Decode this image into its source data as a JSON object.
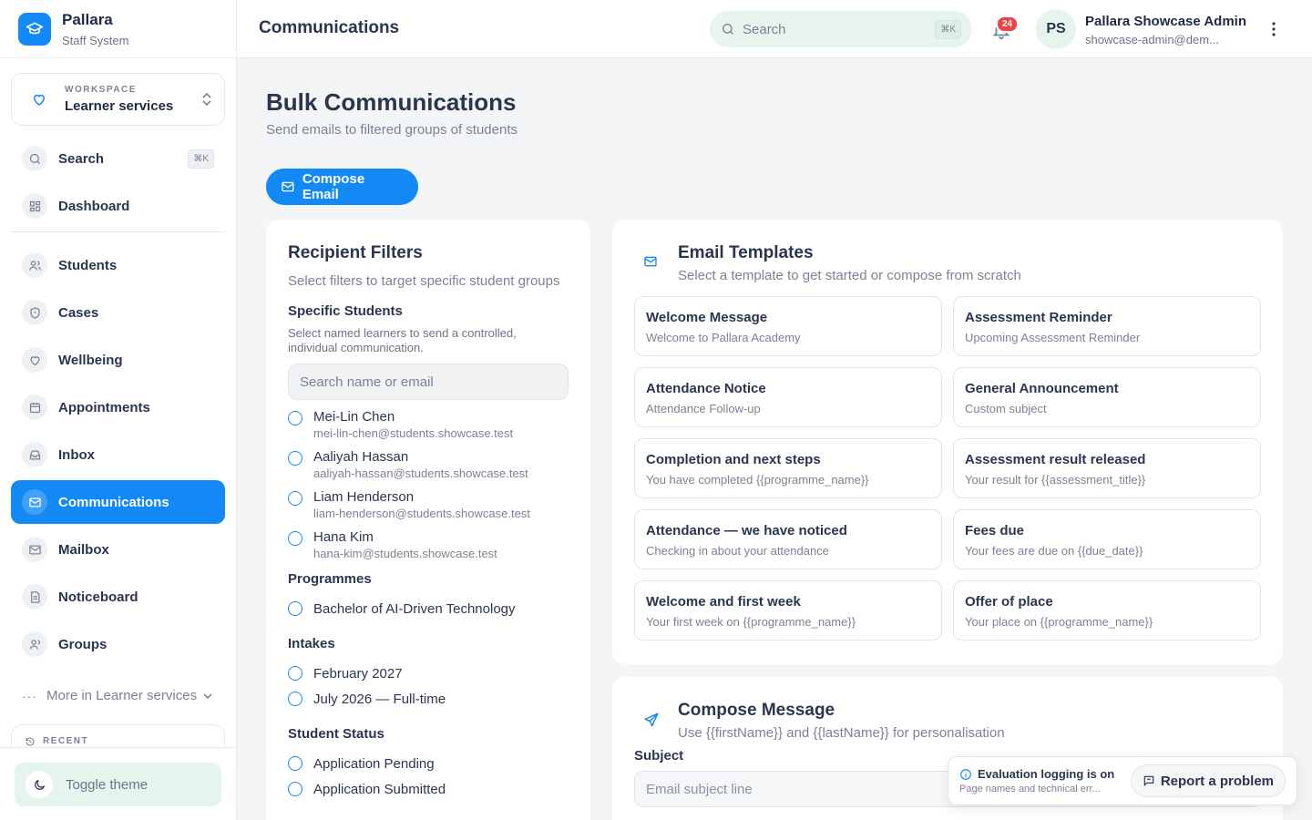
{
  "brand": {
    "name": "Pallara",
    "subtitle": "Staff System"
  },
  "workspace": {
    "label": "WORKSPACE",
    "value": "Learner services"
  },
  "sidebar": {
    "search": {
      "label": "Search",
      "shortcut": "⌘K"
    },
    "dashboard": "Dashboard",
    "items": [
      {
        "label": "Students",
        "icon": "users-icon"
      },
      {
        "label": "Cases",
        "icon": "shield-icon"
      },
      {
        "label": "Wellbeing",
        "icon": "heart-icon"
      },
      {
        "label": "Appointments",
        "icon": "calendar-icon"
      },
      {
        "label": "Inbox",
        "icon": "inbox-icon"
      },
      {
        "label": "Communications",
        "icon": "mail-icon",
        "active": true
      },
      {
        "label": "Mailbox",
        "icon": "mail-icon"
      },
      {
        "label": "Noticeboard",
        "icon": "document-icon"
      },
      {
        "label": "Groups",
        "icon": "group-icon"
      }
    ],
    "more": "More in Learner services",
    "recent": "RECENT",
    "toggle_theme": "Toggle theme"
  },
  "topbar": {
    "title": "Communications",
    "search_placeholder": "Search",
    "search_shortcut": "⌘K",
    "notifications": "24",
    "avatar_initials": "PS",
    "user_name": "Pallara Showcase Admin",
    "user_email": "showcase-admin@dem..."
  },
  "page": {
    "title": "Bulk Communications",
    "subtitle": "Send emails to filtered groups of students",
    "compose_button": "Compose Email"
  },
  "filters": {
    "title": "Recipient Filters",
    "subtitle": "Select filters to target specific student groups",
    "specific": {
      "title": "Specific Students",
      "hint": "Select named learners to send a controlled, individual communication.",
      "search_placeholder": "Search name or email",
      "students": [
        {
          "name": "Mei-Lin Chen",
          "email": "mei-lin-chen@students.showcase.test"
        },
        {
          "name": "Aaliyah Hassan",
          "email": "aaliyah-hassan@students.showcase.test"
        },
        {
          "name": "Liam Henderson",
          "email": "liam-henderson@students.showcase.test"
        },
        {
          "name": "Hana Kim",
          "email": "hana-kim@students.showcase.test"
        }
      ]
    },
    "programmes": {
      "title": "Programmes",
      "options": [
        "Bachelor of AI-Driven Technology"
      ]
    },
    "intakes": {
      "title": "Intakes",
      "options": [
        "February 2027",
        "July 2026 — Full-time"
      ]
    },
    "status": {
      "title": "Student Status",
      "options": [
        "Application Pending",
        "Application Submitted"
      ]
    }
  },
  "templates": {
    "title": "Email Templates",
    "subtitle": "Select a template to get started or compose from scratch",
    "items": [
      {
        "name": "Welcome Message",
        "subject": "Welcome to Pallara Academy"
      },
      {
        "name": "Assessment Reminder",
        "subject": "Upcoming Assessment Reminder"
      },
      {
        "name": "Attendance Notice",
        "subject": "Attendance Follow-up"
      },
      {
        "name": "General Announcement",
        "subject": "Custom subject"
      },
      {
        "name": "Completion and next steps",
        "subject": "You have completed {{programme_name}}"
      },
      {
        "name": "Assessment result released",
        "subject": "Your result for {{assessment_title}}"
      },
      {
        "name": "Attendance — we have noticed",
        "subject": "Checking in about your attendance"
      },
      {
        "name": "Fees due",
        "subject": "Your fees are due on {{due_date}}"
      },
      {
        "name": "Welcome and first week",
        "subject": "Your first week on {{programme_name}}"
      },
      {
        "name": "Offer of place",
        "subject": "Your place on {{programme_name}}"
      }
    ]
  },
  "compose": {
    "title": "Compose Message",
    "subtitle": "Use {{firstName}} and {{lastName}} for personalisation",
    "subject_label": "Subject",
    "subject_placeholder": "Email subject line"
  },
  "toast": {
    "title": "Evaluation logging is on",
    "text": "Page names and technical err...",
    "report_button": "Report a problem"
  },
  "colors": {
    "accent": "#1389f5",
    "badge": "#ef4444",
    "mint": "#e8f5ef"
  }
}
